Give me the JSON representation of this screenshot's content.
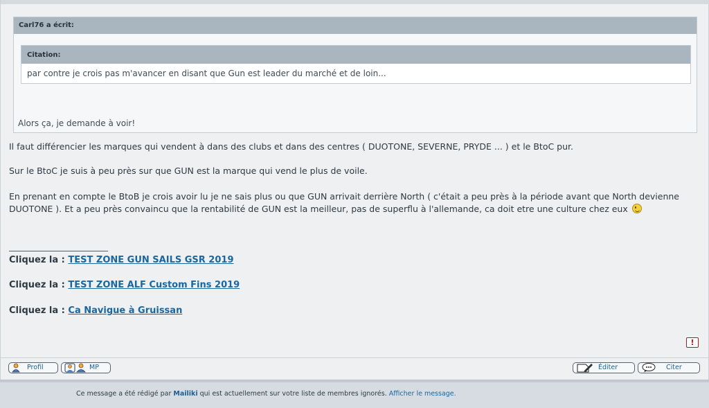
{
  "quote": {
    "author_header": "Carl76 a écrit:",
    "nested": {
      "header": "Citation:",
      "text": "par contre je crois pas m'avancer en disant que Gun est leader du marché et de loin..."
    },
    "reply": "Alors ça, je demande à voir!"
  },
  "body": {
    "p1": "Il faut différencier les marques qui vendent à dans des clubs et dans des centres ( DUOTONE, SEVERNE, PRYDE ... ) et le BtoC pur.",
    "p2": "Sur le BtoC je suis à peu près sur que GUN est la marque qui vend le plus de voile.",
    "p3": "En prenant en compte le BtoB je crois avoir lu je ne sais plus ou que GUN arrivait derrière North ( c'était a peu près à la période avant que North devienne DUOTONE ). Et a peu près convaincu que la rentabilité de GUN est la meilleur, pas de superflu à l'allemande, ca doit etre une culture chez eux",
    "smiley": "wink-smiley-icon"
  },
  "signature": {
    "links": [
      {
        "prefix": "Cliquez la : ",
        "label": "TEST ZONE GUN SAILS GSR 2019"
      },
      {
        "prefix": "Cliquez la : ",
        "label": "TEST ZONE ALF Custom Fins 2019"
      },
      {
        "prefix": "Cliquez la : ",
        "label": "Ca Navigue à Gruissan"
      }
    ]
  },
  "report": {
    "label": "!"
  },
  "actions": {
    "profil": "Profil",
    "mp": "MP",
    "editer": "Éditer",
    "citer": "Citer"
  },
  "ignored_bar": {
    "prefix": "Ce message a été rédigé par ",
    "user": "Mailiki",
    "middle": " qui est actuellement sur votre liste de membres ignorés. ",
    "link": "Afficher le message."
  },
  "colors": {
    "link": "#1a67a0",
    "header_bg": "#a9b5bf",
    "page_bg": "#eef0f2"
  }
}
